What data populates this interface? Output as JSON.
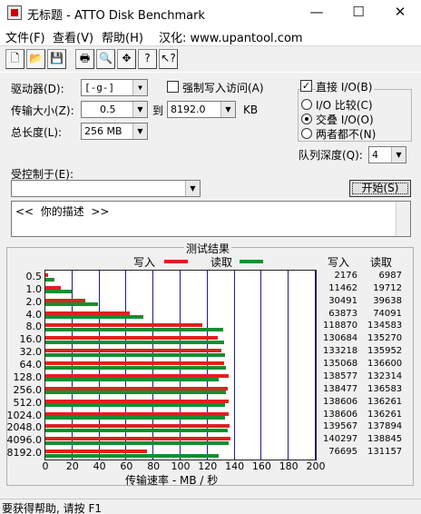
{
  "window": {
    "title": "无标题 - ATTO Disk Benchmark",
    "minimize": "—",
    "maximize": "☐",
    "close": "✕"
  },
  "menu": {
    "file": "文件(F)",
    "view": "查看(V)",
    "help": "帮助(H)",
    "chinese": "汉化: www.upantool.com"
  },
  "toolbar": [
    {
      "name": "new-icon",
      "glyph": "🗋"
    },
    {
      "name": "open-icon",
      "glyph": "📂"
    },
    {
      "name": "save-icon",
      "glyph": "💾"
    },
    {
      "name": "print-icon",
      "glyph": "🖶"
    },
    {
      "name": "print-preview-icon",
      "glyph": "🔍"
    },
    {
      "name": "move-icon",
      "glyph": "✥"
    },
    {
      "name": "help-icon",
      "glyph": "?"
    },
    {
      "name": "context-help-icon",
      "glyph": "↖?"
    }
  ],
  "settings": {
    "drive_label": "驱动器(D):",
    "drive_value": "[-g-]",
    "transfer_label": "传输大小(Z):",
    "transfer_from": "0.5",
    "transfer_to_label": "到",
    "transfer_to": "8192.0",
    "transfer_unit": "KB",
    "total_label": "总长度(L):",
    "total_value": "256 MB",
    "force_write_label": "强制写入访问(A)",
    "direct_io_label": "直接 I/O(B)",
    "direct_io_checked": "✓",
    "io_compare_label": "I/O 比较(C)",
    "overlapped_io_label": "交叠 I/O(O)",
    "neither_label": "两者都不(N)",
    "queue_label": "队列深度(Q):",
    "queue_value": "4",
    "controlled_by_label": "受控制于(E):",
    "controlled_by_value": "",
    "start_button": "开始(S)",
    "description": "<<  你的描述  >>"
  },
  "results": {
    "title": "测试结果",
    "legend_write": "写入",
    "legend_read": "读取",
    "col_write": "写入",
    "col_read": "读取",
    "xlabel": "传输速率 - MB / 秒"
  },
  "chart_data": {
    "type": "bar",
    "orientation": "horizontal",
    "title": "测试结果",
    "xlabel": "传输速率 - MB / 秒",
    "xlim": [
      0,
      200
    ],
    "xticks": [
      "0",
      "20",
      "40",
      "60",
      "80",
      "100",
      "120",
      "140",
      "160",
      "180",
      "200"
    ],
    "colors": {
      "write": "#e02020",
      "read": "#109030"
    },
    "categories": [
      "0.5",
      "1.0",
      "2.0",
      "4.0",
      "8.0",
      "16.0",
      "32.0",
      "64.0",
      "128.0",
      "256.0",
      "512.0",
      "1024.0",
      "2048.0",
      "4096.0",
      "8192.0"
    ],
    "series": [
      {
        "name": "写入",
        "values": [
          2.1,
          11.2,
          29.8,
          62.4,
          116.1,
          127.8,
          130.1,
          131.9,
          135.3,
          135.2,
          135.4,
          135.4,
          136.3,
          137.0,
          74.9
        ]
      },
      {
        "name": "读取",
        "values": [
          6.8,
          19.2,
          38.7,
          72.3,
          131.4,
          132.1,
          132.8,
          133.4,
          128.5,
          133.8,
          133.1,
          133.1,
          134.7,
          135.6,
          128.1
        ]
      }
    ],
    "write_kbps": [
      "2176",
      "11462",
      "30491",
      "63873",
      "118870",
      "130684",
      "133218",
      "135068",
      "138577",
      "138477",
      "138606",
      "138606",
      "139567",
      "140297",
      "76695"
    ],
    "read_kbps": [
      "6987",
      "19712",
      "39638",
      "74091",
      "134583",
      "135270",
      "135952",
      "136600",
      "132314",
      "136583",
      "136261",
      "136261",
      "137894",
      "138845",
      "131157"
    ]
  },
  "status": "要获得帮助, 请按 F1"
}
